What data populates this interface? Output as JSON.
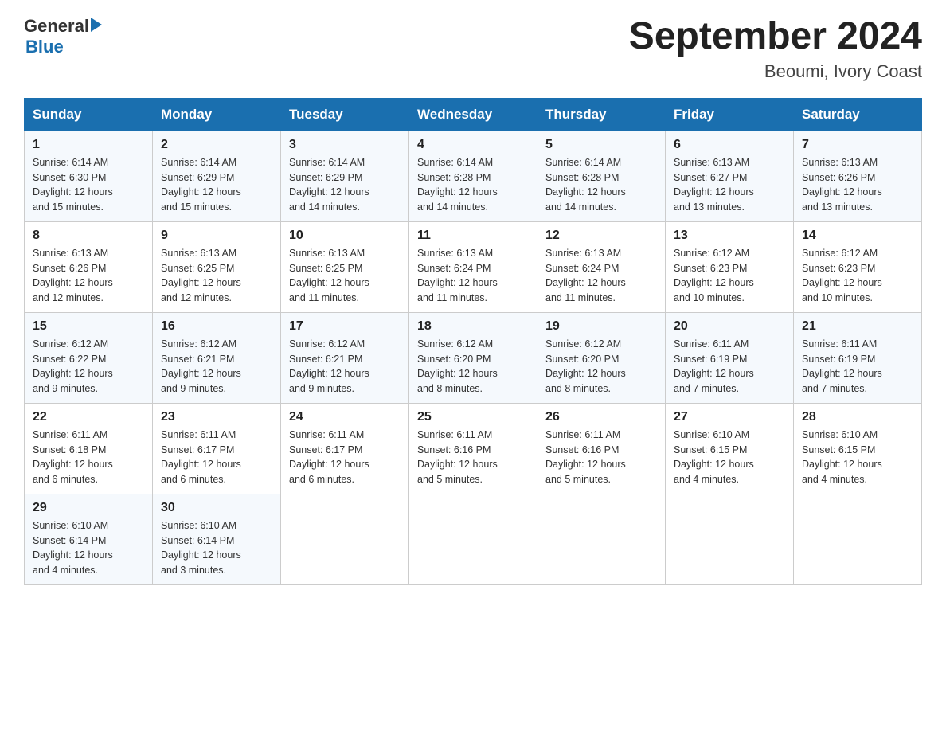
{
  "header": {
    "logo_general": "General",
    "logo_blue": "Blue",
    "month_title": "September 2024",
    "location": "Beoumi, Ivory Coast"
  },
  "weekdays": [
    "Sunday",
    "Monday",
    "Tuesday",
    "Wednesday",
    "Thursday",
    "Friday",
    "Saturday"
  ],
  "weeks": [
    [
      {
        "day": "1",
        "sunrise": "6:14 AM",
        "sunset": "6:30 PM",
        "daylight": "12 hours and 15 minutes."
      },
      {
        "day": "2",
        "sunrise": "6:14 AM",
        "sunset": "6:29 PM",
        "daylight": "12 hours and 15 minutes."
      },
      {
        "day": "3",
        "sunrise": "6:14 AM",
        "sunset": "6:29 PM",
        "daylight": "12 hours and 14 minutes."
      },
      {
        "day": "4",
        "sunrise": "6:14 AM",
        "sunset": "6:28 PM",
        "daylight": "12 hours and 14 minutes."
      },
      {
        "day": "5",
        "sunrise": "6:14 AM",
        "sunset": "6:28 PM",
        "daylight": "12 hours and 14 minutes."
      },
      {
        "day": "6",
        "sunrise": "6:13 AM",
        "sunset": "6:27 PM",
        "daylight": "12 hours and 13 minutes."
      },
      {
        "day": "7",
        "sunrise": "6:13 AM",
        "sunset": "6:26 PM",
        "daylight": "12 hours and 13 minutes."
      }
    ],
    [
      {
        "day": "8",
        "sunrise": "6:13 AM",
        "sunset": "6:26 PM",
        "daylight": "12 hours and 12 minutes."
      },
      {
        "day": "9",
        "sunrise": "6:13 AM",
        "sunset": "6:25 PM",
        "daylight": "12 hours and 12 minutes."
      },
      {
        "day": "10",
        "sunrise": "6:13 AM",
        "sunset": "6:25 PM",
        "daylight": "12 hours and 11 minutes."
      },
      {
        "day": "11",
        "sunrise": "6:13 AM",
        "sunset": "6:24 PM",
        "daylight": "12 hours and 11 minutes."
      },
      {
        "day": "12",
        "sunrise": "6:13 AM",
        "sunset": "6:24 PM",
        "daylight": "12 hours and 11 minutes."
      },
      {
        "day": "13",
        "sunrise": "6:12 AM",
        "sunset": "6:23 PM",
        "daylight": "12 hours and 10 minutes."
      },
      {
        "day": "14",
        "sunrise": "6:12 AM",
        "sunset": "6:23 PM",
        "daylight": "12 hours and 10 minutes."
      }
    ],
    [
      {
        "day": "15",
        "sunrise": "6:12 AM",
        "sunset": "6:22 PM",
        "daylight": "12 hours and 9 minutes."
      },
      {
        "day": "16",
        "sunrise": "6:12 AM",
        "sunset": "6:21 PM",
        "daylight": "12 hours and 9 minutes."
      },
      {
        "day": "17",
        "sunrise": "6:12 AM",
        "sunset": "6:21 PM",
        "daylight": "12 hours and 9 minutes."
      },
      {
        "day": "18",
        "sunrise": "6:12 AM",
        "sunset": "6:20 PM",
        "daylight": "12 hours and 8 minutes."
      },
      {
        "day": "19",
        "sunrise": "6:12 AM",
        "sunset": "6:20 PM",
        "daylight": "12 hours and 8 minutes."
      },
      {
        "day": "20",
        "sunrise": "6:11 AM",
        "sunset": "6:19 PM",
        "daylight": "12 hours and 7 minutes."
      },
      {
        "day": "21",
        "sunrise": "6:11 AM",
        "sunset": "6:19 PM",
        "daylight": "12 hours and 7 minutes."
      }
    ],
    [
      {
        "day": "22",
        "sunrise": "6:11 AM",
        "sunset": "6:18 PM",
        "daylight": "12 hours and 6 minutes."
      },
      {
        "day": "23",
        "sunrise": "6:11 AM",
        "sunset": "6:17 PM",
        "daylight": "12 hours and 6 minutes."
      },
      {
        "day": "24",
        "sunrise": "6:11 AM",
        "sunset": "6:17 PM",
        "daylight": "12 hours and 6 minutes."
      },
      {
        "day": "25",
        "sunrise": "6:11 AM",
        "sunset": "6:16 PM",
        "daylight": "12 hours and 5 minutes."
      },
      {
        "day": "26",
        "sunrise": "6:11 AM",
        "sunset": "6:16 PM",
        "daylight": "12 hours and 5 minutes."
      },
      {
        "day": "27",
        "sunrise": "6:10 AM",
        "sunset": "6:15 PM",
        "daylight": "12 hours and 4 minutes."
      },
      {
        "day": "28",
        "sunrise": "6:10 AM",
        "sunset": "6:15 PM",
        "daylight": "12 hours and 4 minutes."
      }
    ],
    [
      {
        "day": "29",
        "sunrise": "6:10 AM",
        "sunset": "6:14 PM",
        "daylight": "12 hours and 4 minutes."
      },
      {
        "day": "30",
        "sunrise": "6:10 AM",
        "sunset": "6:14 PM",
        "daylight": "12 hours and 3 minutes."
      },
      null,
      null,
      null,
      null,
      null
    ]
  ]
}
